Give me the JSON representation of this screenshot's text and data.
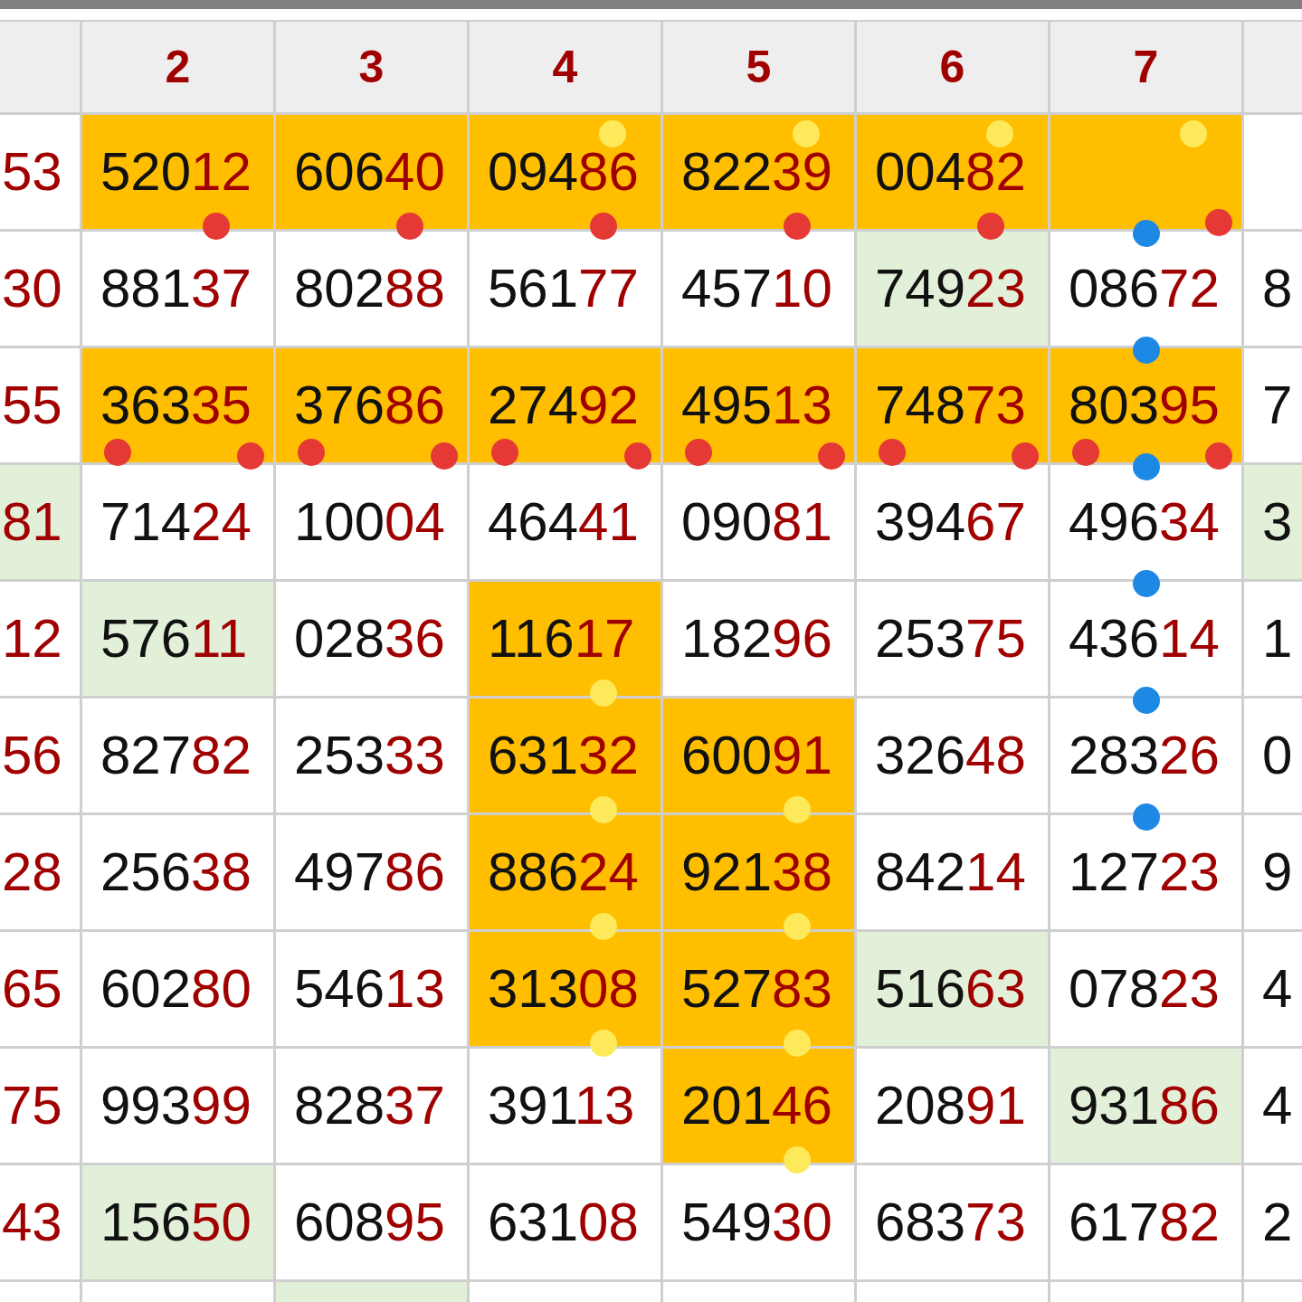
{
  "columns": [
    {
      "label": "2"
    },
    {
      "label": "3"
    },
    {
      "label": "4"
    },
    {
      "label": "5"
    },
    {
      "label": "6"
    },
    {
      "label": "7"
    }
  ],
  "rows": [
    {
      "cells": [
        {
          "text": "53"
        },
        {
          "text": "520**12**",
          "color": "#ffbf00",
          "dots": [
            {
              "color": "#e53935",
              "kind": "bottom"
            }
          ]
        },
        {
          "text": "606**40**",
          "color": "#ffbf00",
          "dots": [
            {
              "color": "#e53935",
              "kind": "bottom"
            }
          ]
        },
        {
          "text": "094**86**",
          "color": "#ffbf00",
          "dots": [
            {
              "color": "#fde95a",
              "kind": "top"
            },
            {
              "color": "#e53935",
              "kind": "bottom"
            }
          ]
        },
        {
          "text": "822**39**",
          "color": "#ffbf00",
          "dots": [
            {
              "color": "#fde95a",
              "kind": "top"
            },
            {
              "color": "#e53935",
              "kind": "bottom"
            }
          ]
        },
        {
          "text": "004**82**",
          "color": "#ffbf00",
          "dots": [
            {
              "color": "#fde95a",
              "kind": "top"
            },
            {
              "color": "#e53935",
              "kind": "bottom"
            }
          ]
        },
        {
          "color": "#ffbf00",
          "dots": [
            {
              "color": "#fde95a",
              "kind": "top"
            },
            {
              "color": "#1e88e5",
              "kind": "center"
            },
            {
              "color": "#e53935",
              "kind": "corner"
            }
          ]
        },
        {}
      ]
    },
    {
      "cells": [
        {
          "text": "30"
        },
        {
          "text": "881**37**"
        },
        {
          "text": "802**88**"
        },
        {
          "text": "561**77**"
        },
        {
          "text": "457**10**"
        },
        {
          "text": "749**23**",
          "color": "#e2f0d9"
        },
        {
          "text": "086**72**",
          "dots": [
            {
              "color": "#1e88e5",
              "kind": "center"
            }
          ]
        },
        {
          "text": "8"
        }
      ]
    },
    {
      "cells": [
        {
          "text": "55"
        },
        {
          "text": "363**35**",
          "color": "#ffbf00",
          "dots": [
            {
              "color": "#e53935",
              "kind": "left"
            },
            {
              "color": "#e53935",
              "kind": "corner"
            }
          ]
        },
        {
          "text": "376**86**",
          "color": "#ffbf00",
          "dots": [
            {
              "color": "#e53935",
              "kind": "left"
            },
            {
              "color": "#e53935",
              "kind": "corner"
            }
          ]
        },
        {
          "text": "274**92**",
          "color": "#ffbf00",
          "dots": [
            {
              "color": "#e53935",
              "kind": "left"
            },
            {
              "color": "#e53935",
              "kind": "corner"
            }
          ]
        },
        {
          "text": "495**13**",
          "color": "#ffbf00",
          "dots": [
            {
              "color": "#e53935",
              "kind": "left"
            },
            {
              "color": "#e53935",
              "kind": "corner"
            }
          ]
        },
        {
          "text": "748**73**",
          "color": "#ffbf00",
          "dots": [
            {
              "color": "#e53935",
              "kind": "left"
            },
            {
              "color": "#e53935",
              "kind": "corner"
            }
          ]
        },
        {
          "text": "803**95**",
          "color": "#ffbf00",
          "dots": [
            {
              "color": "#e53935",
              "kind": "left"
            },
            {
              "color": "#1e88e5",
              "kind": "center"
            },
            {
              "color": "#e53935",
              "kind": "corner"
            }
          ]
        },
        {
          "text": "7"
        }
      ]
    },
    {
      "cells": [
        {
          "text": "81",
          "color": "#e2f0d9"
        },
        {
          "text": "714**24**"
        },
        {
          "text": "100**04**"
        },
        {
          "text": "464**41**"
        },
        {
          "text": "090**81**"
        },
        {
          "text": "394**67**"
        },
        {
          "text": "496**34**",
          "dots": [
            {
              "color": "#1e88e5",
              "kind": "center"
            }
          ]
        },
        {
          "text": "3",
          "color": "#e2f0d9"
        }
      ]
    },
    {
      "cells": [
        {
          "text": "12"
        },
        {
          "text": "576**11**",
          "color": "#e2f0d9"
        },
        {
          "text": "028**36**"
        },
        {
          "text": "116**17**",
          "color": "#ffbf00",
          "dots": [
            {
              "color": "#fde95a",
              "kind": "bottom"
            }
          ]
        },
        {
          "text": "182**96**"
        },
        {
          "text": "253**75**"
        },
        {
          "text": "436**14**",
          "dots": [
            {
              "color": "#1e88e5",
              "kind": "center"
            }
          ]
        },
        {
          "text": "1"
        }
      ]
    },
    {
      "cells": [
        {
          "text": "56"
        },
        {
          "text": "827**82**"
        },
        {
          "text": "253**33**"
        },
        {
          "text": "631**32**",
          "color": "#ffbf00",
          "dots": [
            {
              "color": "#fde95a",
              "kind": "bottom"
            }
          ]
        },
        {
          "text": "600**91**",
          "color": "#ffbf00",
          "dots": [
            {
              "color": "#fde95a",
              "kind": "bottom"
            }
          ]
        },
        {
          "text": "326**48**"
        },
        {
          "text": "283**26**",
          "dots": [
            {
              "color": "#1e88e5",
              "kind": "center"
            }
          ]
        },
        {
          "text": "0"
        }
      ]
    },
    {
      "cells": [
        {
          "text": "28"
        },
        {
          "text": "256**38**"
        },
        {
          "text": "497**86**"
        },
        {
          "text": "886**24**",
          "color": "#ffbf00",
          "dots": [
            {
              "color": "#fde95a",
              "kind": "bottom"
            }
          ]
        },
        {
          "text": "921**38**",
          "color": "#ffbf00",
          "dots": [
            {
              "color": "#fde95a",
              "kind": "bottom"
            }
          ]
        },
        {
          "text": "842**14**"
        },
        {
          "text": "127**23**"
        },
        {
          "text": "9"
        }
      ]
    },
    {
      "cells": [
        {
          "text": "65"
        },
        {
          "text": "602**80**"
        },
        {
          "text": "546**13**"
        },
        {
          "text": "313**08**",
          "color": "#ffbf00",
          "dots": [
            {
              "color": "#fde95a",
              "kind": "bottom"
            }
          ]
        },
        {
          "text": "527**83**",
          "color": "#ffbf00",
          "dots": [
            {
              "color": "#fde95a",
              "kind": "bottom"
            }
          ]
        },
        {
          "text": "516**63**",
          "color": "#e2f0d9"
        },
        {
          "text": "078**23**"
        },
        {
          "text": "4"
        }
      ]
    },
    {
      "cells": [
        {
          "text": "75"
        },
        {
          "text": "993**99**"
        },
        {
          "text": "828**37**"
        },
        {
          "text": "391**13**"
        },
        {
          "text": "201**46**",
          "color": "#ffbf00",
          "dots": [
            {
              "color": "#fde95a",
              "kind": "bottom"
            }
          ]
        },
        {
          "text": "208**91**"
        },
        {
          "text": "931**86**",
          "color": "#e2f0d9"
        },
        {
          "text": "4"
        }
      ]
    },
    {
      "cells": [
        {
          "text": "43"
        },
        {
          "text": "156**50**",
          "color": "#e2f0d9"
        },
        {
          "text": "608**95**"
        },
        {
          "text": "631**08**"
        },
        {
          "text": "549**30**"
        },
        {
          "text": "683**73**"
        },
        {
          "text": "617**82**"
        },
        {
          "text": "2"
        }
      ]
    },
    {
      "cells": [
        {},
        {},
        {
          "color": "#e2f0d9"
        },
        {},
        {},
        {},
        {},
        {}
      ]
    }
  ]
}
